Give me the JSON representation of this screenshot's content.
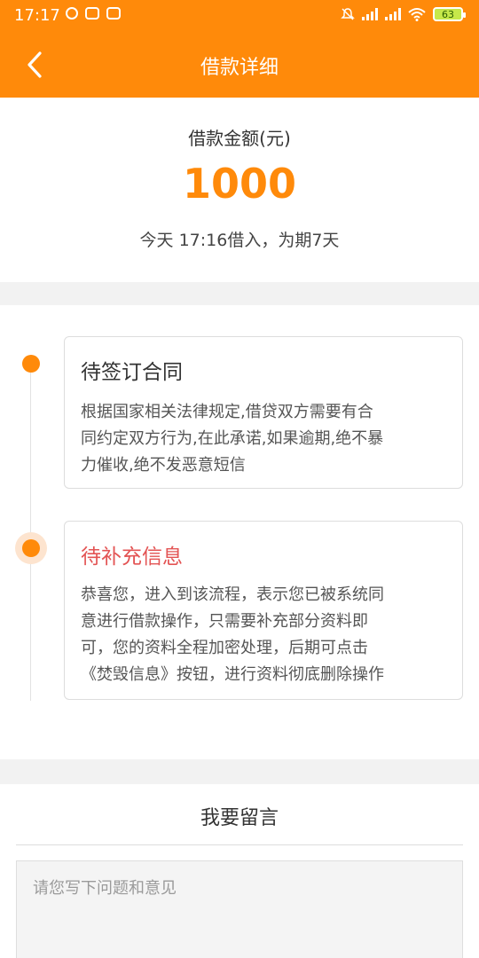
{
  "status": {
    "time": "17:17",
    "battery": "63"
  },
  "nav": {
    "title": "借款详细"
  },
  "summary": {
    "label": "借款金额(元)",
    "amount": "1000",
    "sub": "今天 17:16借入，为期7天"
  },
  "steps": [
    {
      "title": "待签订合同",
      "desc_lines": [
        "根据国家相关法律规定,借贷双方需要有合",
        "同约定双方行为,在此承诺,如果逾期,绝不暴",
        "力催收,绝不发恶意短信"
      ]
    },
    {
      "title": "待补充信息",
      "desc_lines": [
        "恭喜您，进入到该流程，表示您已被系统同",
        "意进行借款操作，只需要补充部分资料即",
        "可，您的资料全程加密处理，后期可点击",
        "《焚毁信息》按钮，进行资料彻底删除操作"
      ]
    }
  ],
  "message": {
    "title": "我要留言",
    "placeholder": "请您写下问题和意见"
  },
  "colors": {
    "accent": "#ff8a0a",
    "highlight": "#e35454"
  }
}
